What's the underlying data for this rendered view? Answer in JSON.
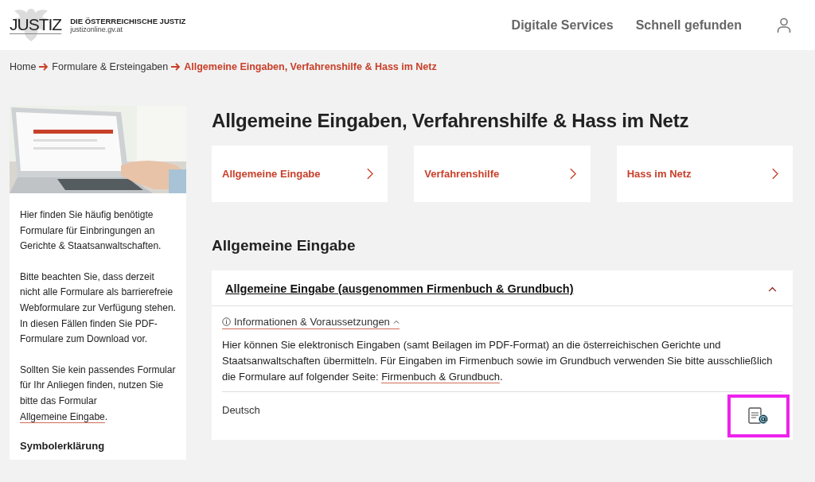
{
  "header": {
    "logo": "JUSTIZ",
    "org_name": "DIE ÖSTERREICHISCHE JUSTIZ",
    "domain": "justizonline.gv.at",
    "nav": [
      "Digitale Services",
      "Schnell gefunden"
    ]
  },
  "breadcrumb": [
    {
      "label": "Home",
      "current": false
    },
    {
      "label": "Formulare & Ersteingaben",
      "current": false
    },
    {
      "label": "Allgemeine Eingaben, Verfahrenshilfe & Hass im Netz",
      "current": true
    }
  ],
  "sidebar": {
    "paragraphs": [
      {
        "text": "Hier finden Sie häufig benötigte Formulare für Einbringungen an Gerichte & Staatsanwaltschaften."
      },
      {
        "text": "Bitte beachten Sie, dass derzeit nicht alle Formulare als barrierefreie Webformulare zur Verfügung stehen. In diesen Fällen finden Sie PDF-Formulare zum Download vor."
      },
      {
        "text": "Sollten Sie kein passendes Formular für Ihr Anliegen finden, nutzen Sie bitte das Formular ",
        "link": "Allgemeine Eingabe",
        "after": "."
      }
    ],
    "heading": "Symbolerklärung"
  },
  "page_title": "Allgemeine Eingaben, Verfahrenshilfe & Hass im Netz",
  "link_cards": [
    "Allgemeine Eingabe",
    "Verfahrenshilfe",
    "Hass im Netz"
  ],
  "section_title": "Allgemeine Eingabe",
  "accordion": {
    "title": "Allgemeine Eingabe (ausgenommen Firmenbuch & Grundbuch)",
    "expanded": true,
    "info_toggle": {
      "label": "Informationen & Voraussetzungen",
      "expanded": true
    },
    "description": {
      "text": "Hier können Sie elektronisch Eingaben (samt Beilagen im PDF-Format) an die österreichischen Gerichte und Staatsanwaltschaften übermitteln. Für Eingaben im Firmenbuch sowie im Grundbuch verwenden Sie bitte ausschließlich die Formulare auf folgender Seite: ",
      "link": "Firmenbuch & Grundbuch",
      "after": "."
    },
    "forms": [
      {
        "language": "Deutsch",
        "highlighted": true
      }
    ]
  }
}
